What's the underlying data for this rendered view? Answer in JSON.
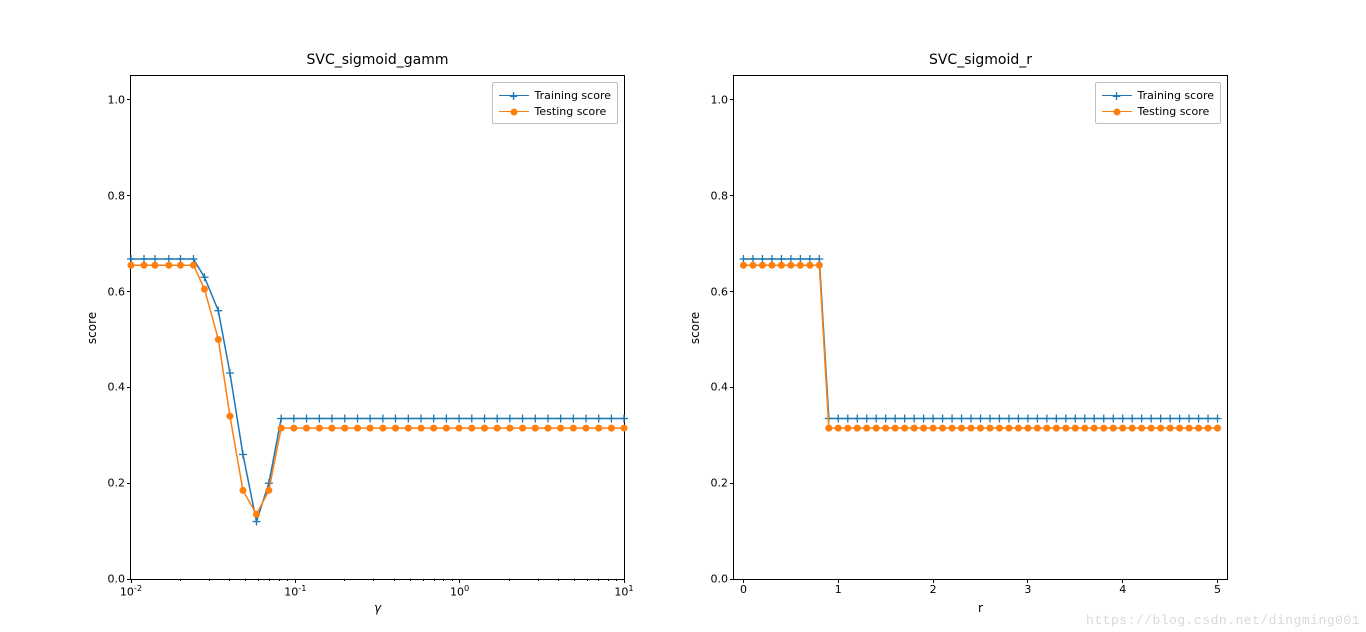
{
  "chart_data": [
    {
      "type": "line",
      "title": "SVC_sigmoid_gamm",
      "xlabel": "γ",
      "ylabel": "score",
      "xscale": "log",
      "xlim": [
        0.01,
        10
      ],
      "ylim": [
        0.0,
        1.05
      ],
      "yticks": [
        0.0,
        0.2,
        0.4,
        0.6,
        0.8,
        1.0
      ],
      "xticks_log_exponents": [
        -2,
        -1,
        0,
        1
      ],
      "legend": [
        "Training score",
        "Testing score"
      ],
      "colors": {
        "train": "#1f77b4",
        "test": "#ff7f0e"
      },
      "x": [
        0.01,
        0.012,
        0.014,
        0.017,
        0.02,
        0.024,
        0.028,
        0.034,
        0.04,
        0.048,
        0.058,
        0.069,
        0.082,
        0.098,
        0.117,
        0.14,
        0.167,
        0.2,
        0.239,
        0.285,
        0.341,
        0.407,
        0.487,
        0.582,
        0.695,
        0.83,
        0.992,
        1.185,
        1.416,
        1.692,
        2.021,
        2.414,
        2.884,
        3.446,
        4.116,
        4.917,
        5.874,
        7.017,
        8.383,
        10.0
      ],
      "series": [
        {
          "name": "Training score",
          "marker": "plus",
          "values": [
            0.668,
            0.668,
            0.668,
            0.668,
            0.668,
            0.668,
            0.63,
            0.56,
            0.43,
            0.26,
            0.12,
            0.2,
            0.335,
            0.335,
            0.335,
            0.335,
            0.335,
            0.335,
            0.335,
            0.335,
            0.335,
            0.335,
            0.335,
            0.335,
            0.335,
            0.335,
            0.335,
            0.335,
            0.335,
            0.335,
            0.335,
            0.335,
            0.335,
            0.335,
            0.335,
            0.335,
            0.335,
            0.335,
            0.335,
            0.335
          ]
        },
        {
          "name": "Testing score",
          "marker": "dot",
          "values": [
            0.655,
            0.655,
            0.655,
            0.655,
            0.655,
            0.655,
            0.605,
            0.5,
            0.34,
            0.185,
            0.135,
            0.185,
            0.315,
            0.315,
            0.315,
            0.315,
            0.315,
            0.315,
            0.315,
            0.315,
            0.315,
            0.315,
            0.315,
            0.315,
            0.315,
            0.315,
            0.315,
            0.315,
            0.315,
            0.315,
            0.315,
            0.315,
            0.315,
            0.315,
            0.315,
            0.315,
            0.315,
            0.315,
            0.315,
            0.315
          ]
        }
      ]
    },
    {
      "type": "line",
      "title": "SVC_sigmoid_r",
      "xlabel": "r",
      "ylabel": "score",
      "xscale": "linear",
      "xlim": [
        -0.1,
        5.1
      ],
      "ylim": [
        0.0,
        1.05
      ],
      "yticks": [
        0.0,
        0.2,
        0.4,
        0.6,
        0.8,
        1.0
      ],
      "xticks_linear": [
        0,
        1,
        2,
        3,
        4,
        5
      ],
      "legend": [
        "Training score",
        "Testing score"
      ],
      "colors": {
        "train": "#1f77b4",
        "test": "#ff7f0e"
      },
      "x": [
        0.0,
        0.1,
        0.2,
        0.3,
        0.4,
        0.5,
        0.6,
        0.7,
        0.8,
        0.9,
        1.0,
        1.1,
        1.2,
        1.3,
        1.4,
        1.5,
        1.6,
        1.7,
        1.8,
        1.9,
        2.0,
        2.1,
        2.2,
        2.3,
        2.4,
        2.5,
        2.6,
        2.7,
        2.8,
        2.9,
        3.0,
        3.1,
        3.2,
        3.3,
        3.4,
        3.5,
        3.6,
        3.7,
        3.8,
        3.9,
        4.0,
        4.1,
        4.2,
        4.3,
        4.4,
        4.5,
        4.6,
        4.7,
        4.8,
        4.9,
        5.0
      ],
      "series": [
        {
          "name": "Training score",
          "marker": "plus",
          "values": [
            0.668,
            0.668,
            0.668,
            0.668,
            0.668,
            0.668,
            0.668,
            0.668,
            0.668,
            0.335,
            0.335,
            0.335,
            0.335,
            0.335,
            0.335,
            0.335,
            0.335,
            0.335,
            0.335,
            0.335,
            0.335,
            0.335,
            0.335,
            0.335,
            0.335,
            0.335,
            0.335,
            0.335,
            0.335,
            0.335,
            0.335,
            0.335,
            0.335,
            0.335,
            0.335,
            0.335,
            0.335,
            0.335,
            0.335,
            0.335,
            0.335,
            0.335,
            0.335,
            0.335,
            0.335,
            0.335,
            0.335,
            0.335,
            0.335,
            0.335,
            0.335
          ]
        },
        {
          "name": "Testing score",
          "marker": "dot",
          "values": [
            0.655,
            0.655,
            0.655,
            0.655,
            0.655,
            0.655,
            0.655,
            0.655,
            0.655,
            0.315,
            0.315,
            0.315,
            0.315,
            0.315,
            0.315,
            0.315,
            0.315,
            0.315,
            0.315,
            0.315,
            0.315,
            0.315,
            0.315,
            0.315,
            0.315,
            0.315,
            0.315,
            0.315,
            0.315,
            0.315,
            0.315,
            0.315,
            0.315,
            0.315,
            0.315,
            0.315,
            0.315,
            0.315,
            0.315,
            0.315,
            0.315,
            0.315,
            0.315,
            0.315,
            0.315,
            0.315,
            0.315,
            0.315,
            0.315,
            0.315,
            0.315
          ]
        }
      ]
    }
  ],
  "watermark": "https://blog.csdn.net/dingming001"
}
